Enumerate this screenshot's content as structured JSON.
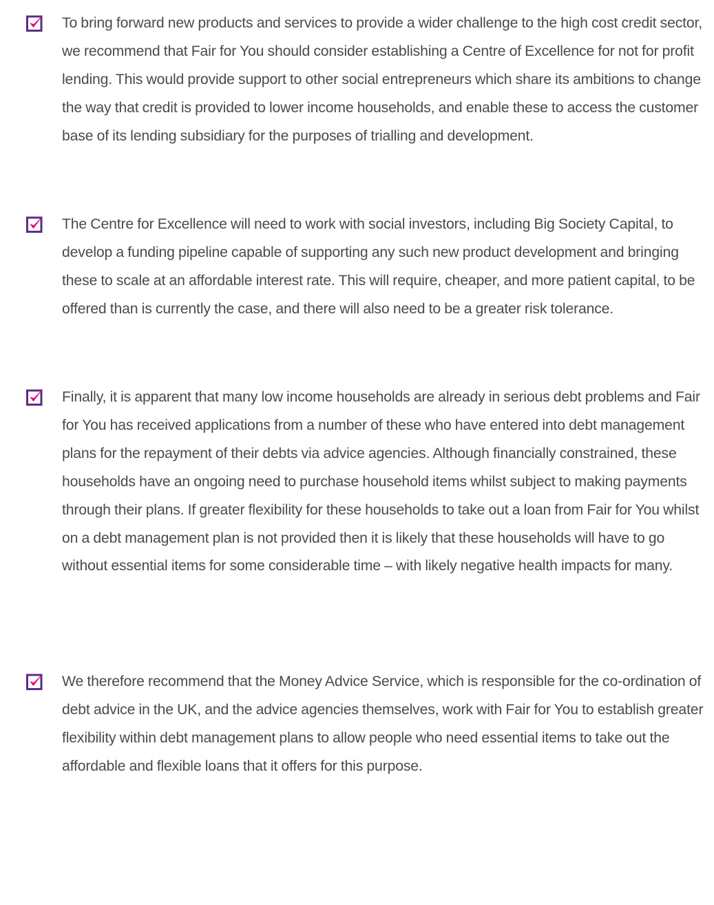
{
  "colors": {
    "checkbox_border": "#5b2d86",
    "checkmark": "#e3007e",
    "text": "#4a4a4a"
  },
  "icon": "checkbox-checked-icon",
  "items": [
    {
      "text": "To bring forward new products and services to provide a wider challenge to the high cost credit sector, we recommend that Fair for You should consider establishing a Centre of Excellence for not for profit lending. This would provide support to other social entrepreneurs which share its ambitions to change the way that credit is provided to lower income households, and enable these to access the customer base of its lending subsidiary for the purposes of trialling and development."
    },
    {
      "text": "The Centre for Excellence will need to work with social investors, including Big Society Capital, to develop a funding pipeline capable of supporting any such new product development and bringing these to scale at an affordable interest rate. This will require, cheaper, and more patient capital, to be offered than is currently the case, and there will also need to be a greater risk tolerance."
    },
    {
      "text": "Finally, it is apparent that many low income households are already in serious debt problems and Fair for You has received applications from a number of these who have entered into debt management plans for the repayment of their debts via advice agencies.  Although financially constrained, these households have an ongoing need to purchase household items whilst subject to making payments through their plans.  If greater flexibility for these households to take out a loan from Fair for You whilst on a debt management plan is not provided then it is likely that these households will have to go without essential items for some considerable time – with likely negative health impacts for many."
    },
    {
      "text": "We therefore recommend that the Money Advice Service, which is responsible for the co-ordination of debt advice in the UK, and the advice agencies themselves, work with Fair for You to establish greater flexibility within debt management plans to allow people who need essential items to take out the affordable and flexible loans that it offers for this purpose."
    }
  ]
}
